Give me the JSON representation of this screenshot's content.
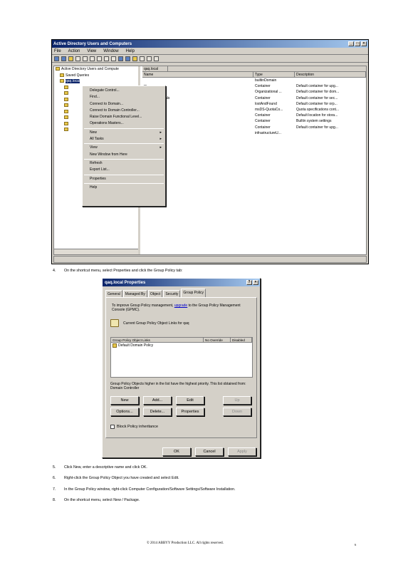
{
  "screenshot1": {
    "title": "Active Directory Users and Computers",
    "menu": [
      "File",
      "Action",
      "View",
      "Window",
      "Help"
    ],
    "tree": [
      "Active Directory Users and Compute",
      "Saved Queries",
      "qaq.local"
    ],
    "list_header": {
      "left": "qaq.local",
      "name": "Name",
      "type": "Type",
      "description": "Description"
    },
    "rows": [
      {
        "name": "",
        "type": "builtinDomain",
        "description": ""
      },
      {
        "name": "rs",
        "type": "Container",
        "description": "Default container for upg..."
      },
      {
        "name": "Controllers",
        "type": "Organizational ...",
        "description": "Default container for dom..."
      },
      {
        "name": "ecurityPrincipals",
        "type": "Container",
        "description": "Default container for sec..."
      },
      {
        "name": "ound",
        "type": "lostAndFound",
        "description": "Default container for orp..."
      },
      {
        "name": "as",
        "type": "msDS-QuotaCo...",
        "description": "Quota specifications cont..."
      },
      {
        "name": "am",
        "type": "Container",
        "description": "Default location for stora..."
      },
      {
        "name": "",
        "type": "Container",
        "description": "Builtin system settings"
      },
      {
        "name": "",
        "type": "Container",
        "description": "Default container for upg..."
      },
      {
        "name": "ucture",
        "type": "infrastructureU...",
        "description": ""
      }
    ],
    "context_menu": [
      "Delegate Control...",
      "Find...",
      "Connect to Domain...",
      "Connect to Domain Controller...",
      "Raise Domain Functional Level...",
      "Operations Masters...",
      "New",
      "All Tasks",
      "View",
      "New Window from Here",
      "Refresh",
      "Export List...",
      "Properties",
      "Help"
    ]
  },
  "steps": [
    {
      "num": "4.",
      "text": "On the shortcut menu, select  Properties  and click the Group Policy  tab:"
    },
    {
      "num": "5.",
      "text": "Click  New, enter a descriptive  name and  click  OK."
    },
    {
      "num": "6.",
      "text": "Right-click the Group Policy Object you  have  created  and  select  Edit."
    },
    {
      "num": "7.",
      "text": "In the Group Policy window,  right-click Computer  Configuration/Software  Settings/Software  Installation."
    },
    {
      "num": "8.",
      "text": "On the shortcut menu, select  New / Package."
    }
  ],
  "screenshot2": {
    "title": "qaq.local Properties",
    "tabs": [
      "General",
      "Managed By",
      "Object",
      "Security",
      "Group Policy"
    ],
    "desc_pre": "To improve Group Policy management, ",
    "desc_link": "upgrade",
    "desc_post": " to the Group Policy Management Console (GPMC).",
    "current": "Current Group Policy Object Links for qaq",
    "col_headers": [
      "Group Policy Object Links",
      "No Override",
      "Disabled"
    ],
    "items": [
      "Default Domain Policy"
    ],
    "priority_note": "Group Policy Objects higher in the list have the highest priority. This list obtained from: Domain Controller",
    "buttons": {
      "new": "New",
      "add": "Add...",
      "edit": "Edit",
      "up": "Up",
      "options": "Options...",
      "delete": "Delete...",
      "properties": "Properties",
      "down": "Down",
      "ok": "OK",
      "cancel": "Cancel",
      "apply": "Apply"
    },
    "block": "Block Policy inheritance"
  },
  "footer": "© 2014 ABBYY Production LLC. All rights reserved.",
  "page_number": "6"
}
